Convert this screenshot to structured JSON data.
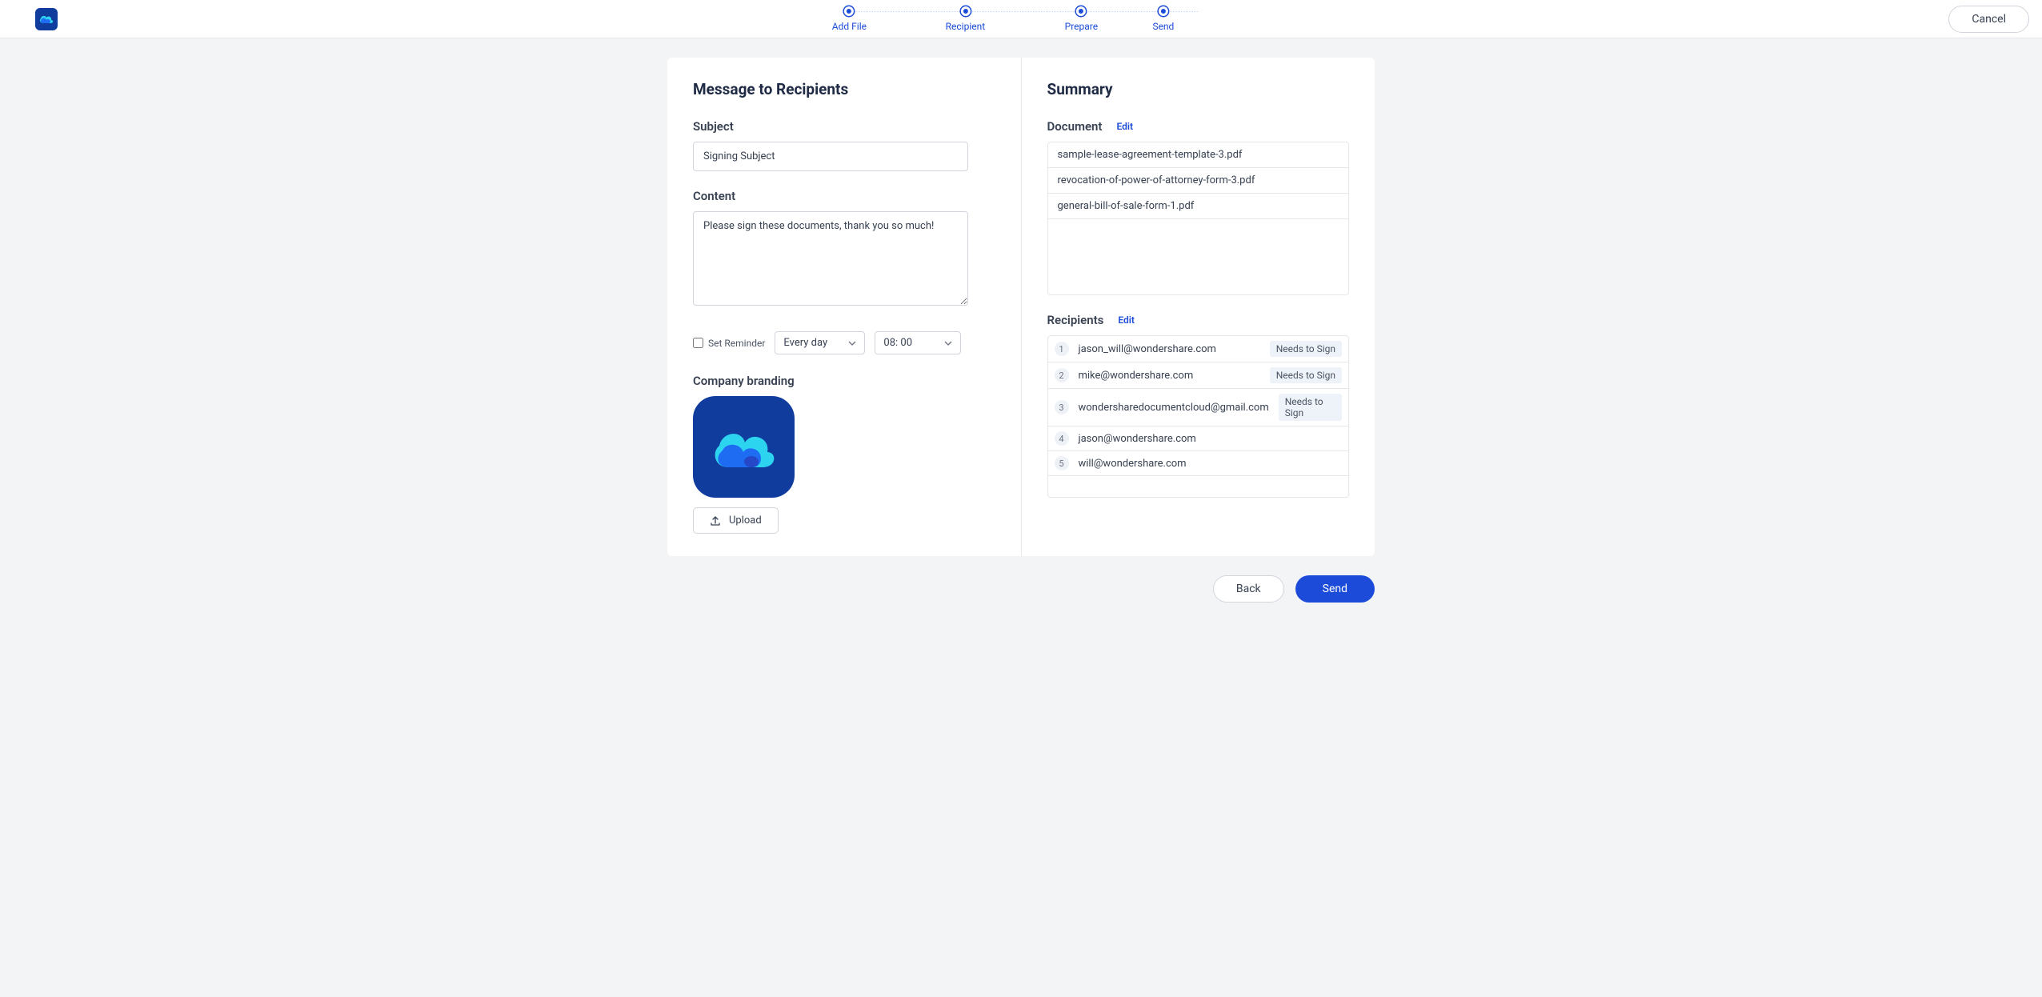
{
  "stepper": {
    "steps": [
      {
        "label": "Add File"
      },
      {
        "label": "Recipient"
      },
      {
        "label": "Prepare"
      },
      {
        "label": "Send"
      }
    ]
  },
  "header": {
    "cancel": "Cancel"
  },
  "left_panel": {
    "title": "Message to Recipients",
    "subject_label": "Subject",
    "subject_value": "Signing Subject",
    "content_label": "Content",
    "content_value": "Please sign these documents, thank you so much!",
    "reminder_label": "Set Reminder",
    "frequency": "Every day",
    "time": "08: 00",
    "branding_label": "Company branding",
    "upload_label": "Upload"
  },
  "right_panel": {
    "title": "Summary",
    "document_label": "Document",
    "document_edit": "Edit",
    "documents": [
      "sample-lease-agreement-template-3.pdf",
      "revocation-of-power-of-attorney-form-3.pdf",
      "general-bill-of-sale-form-1.pdf"
    ],
    "recipients_label": "Recipients",
    "recipients_edit": "Edit",
    "needs_sign": "Needs to Sign",
    "recipients": [
      {
        "n": "1",
        "email": "jason_will@wondershare.com",
        "needs_sign": true
      },
      {
        "n": "2",
        "email": "mike@wondershare.com",
        "needs_sign": true
      },
      {
        "n": "3",
        "email": "wondersharedocumentcloud@gmail.com",
        "needs_sign": true
      },
      {
        "n": "4",
        "email": "jason@wondershare.com",
        "needs_sign": false
      },
      {
        "n": "5",
        "email": "will@wondershare.com",
        "needs_sign": false
      }
    ]
  },
  "footer": {
    "back": "Back",
    "send": "Send"
  }
}
